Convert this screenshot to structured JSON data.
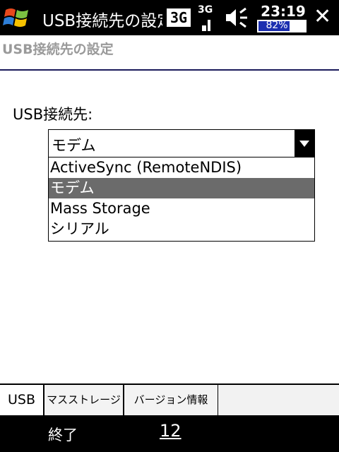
{
  "statusbar": {
    "title": "USB接続先の設定",
    "signal_3g_label": "3G",
    "signal_3g_small_label": "3G",
    "time": "23:19",
    "battery_text": "82%",
    "battery_level_percent": 82,
    "icons": [
      "windows-start-icon",
      "3g-signal-icon",
      "3g-signal-bars-icon",
      "speaker-icon",
      "close-icon"
    ]
  },
  "header": {
    "title": "USB接続先の設定"
  },
  "form": {
    "usb_label": "USB接続先:",
    "combo_value": "モデム",
    "options": [
      {
        "label": "ActiveSync (RemoteNDIS)",
        "selected": false
      },
      {
        "label": "モデム",
        "selected": true
      },
      {
        "label": "Mass Storage",
        "selected": false
      },
      {
        "label": "シリアル",
        "selected": false
      }
    ]
  },
  "tabs": [
    {
      "label": "USB",
      "active": true
    },
    {
      "label": "マスストレージ",
      "active": false
    },
    {
      "label": "バージョン情報",
      "active": false
    }
  ],
  "softkeys": {
    "left": "終了",
    "center": "12"
  },
  "colors": {
    "selected_option_bg": "#6b6b6b",
    "battery_fill": "#1c2fb0",
    "header_line": "#1a1a5a"
  }
}
